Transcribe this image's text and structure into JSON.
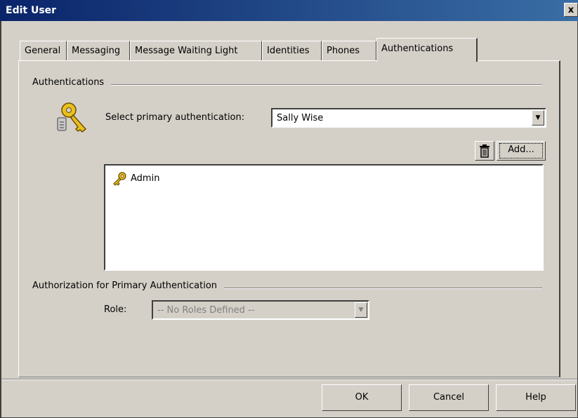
{
  "window": {
    "title": "Edit User",
    "close_label": "x"
  },
  "tabs": [
    {
      "label": "General"
    },
    {
      "label": "Messaging"
    },
    {
      "label": "Message Waiting Light"
    },
    {
      "label": "Identities"
    },
    {
      "label": "Phones"
    },
    {
      "label": "Authentications",
      "active": true
    }
  ],
  "authentications": {
    "group_label": "Authentications",
    "select_label": "Select primary authentication:",
    "select_value": "Sally Wise",
    "add_label": "Add...",
    "list": [
      {
        "label": "Admin",
        "icon": "key-icon"
      }
    ]
  },
  "authorization": {
    "group_label": "Authorization for Primary Authentication",
    "role_label": "Role:",
    "role_value": "-- No Roles Defined --"
  },
  "buttons": {
    "ok": "OK",
    "cancel": "Cancel",
    "help": "Help"
  }
}
